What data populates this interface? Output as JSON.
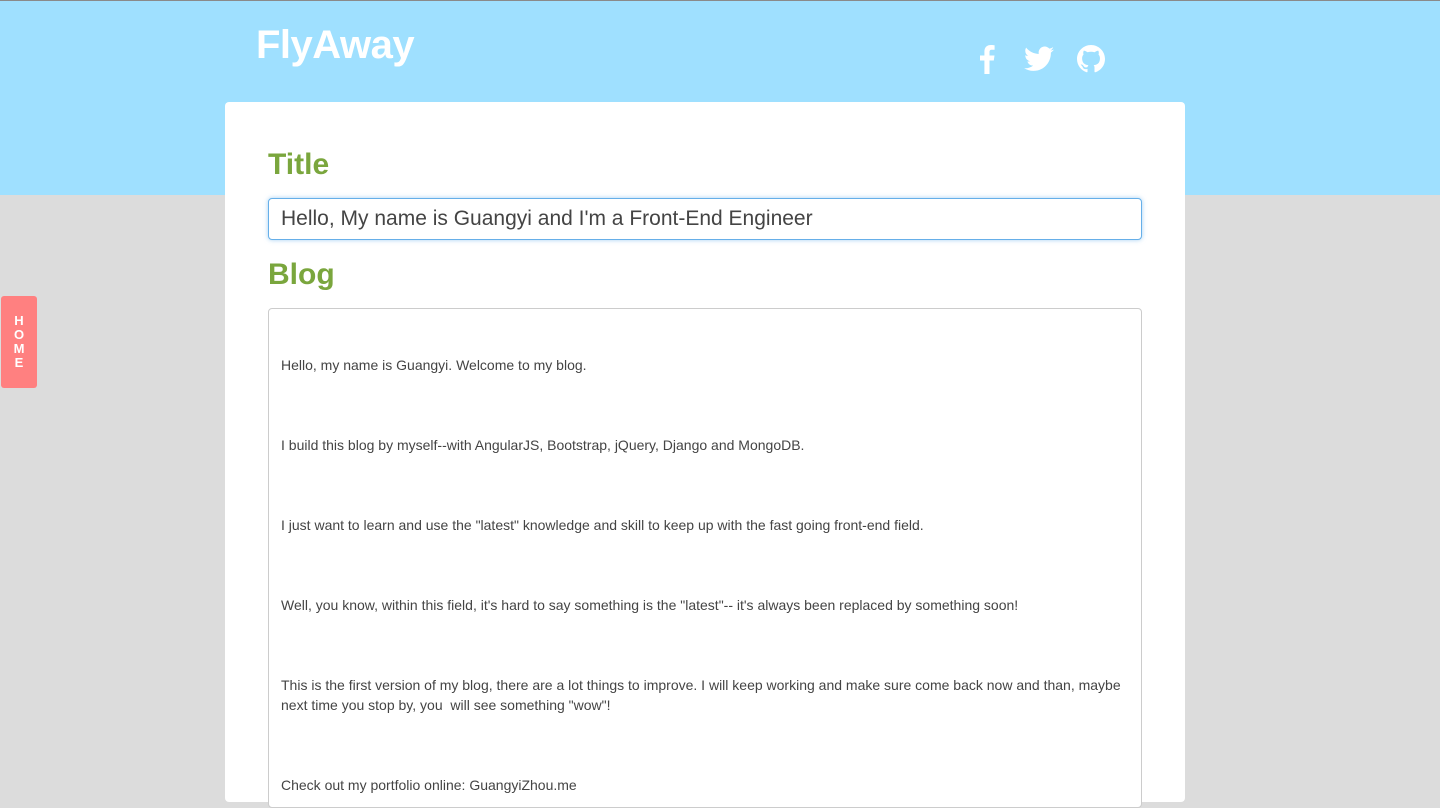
{
  "header": {
    "brand": "FlyAway",
    "colors": {
      "background": "#9fe0ff",
      "brand_text": "#ffffff"
    },
    "social": [
      {
        "name": "facebook",
        "icon": "facebook-icon"
      },
      {
        "name": "twitter",
        "icon": "twitter-icon"
      },
      {
        "name": "github",
        "icon": "github-icon"
      }
    ]
  },
  "side_tab": {
    "letters": [
      "H",
      "O",
      "M",
      "E"
    ],
    "color": "#ff8080"
  },
  "editor": {
    "title_label": "Title",
    "title_value": "Hello, My name is Guangyi and I'm a Front-End Engineer",
    "blog_label": "Blog",
    "blog_paragraphs": [
      "Hello, my name is Guangyi. Welcome to my blog.",
      "I build this blog by myself--with AngularJS, Bootstrap, jQuery, Django and MongoDB.",
      "I just want to learn and use the \"latest\" knowledge and skill to keep up with the fast going front-end field.",
      "Well, you know, within this field, it's hard to say something is the \"latest\"-- it's always been replaced by something soon!",
      "This is the first version of my blog, there are a lot things to improve. I will keep working and make sure come back now and than, maybe next time you stop by, you  will see something \"wow\"!",
      "Check out my portfolio online: GuangyiZhou.me"
    ],
    "label_color": "#7aa63d"
  }
}
